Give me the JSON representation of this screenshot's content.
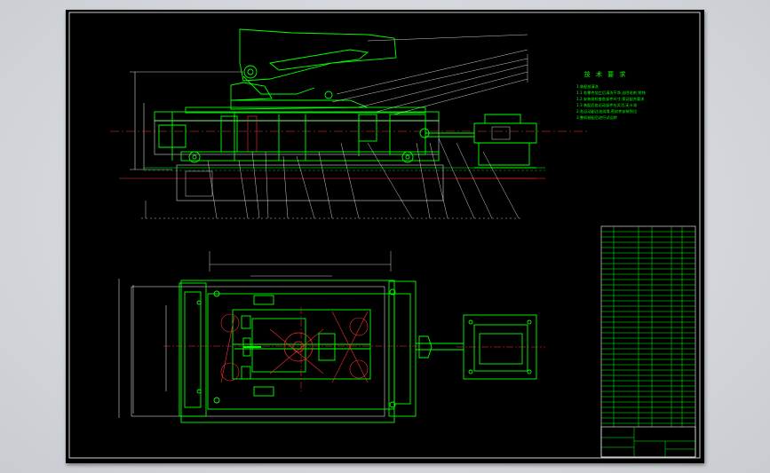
{
  "drawing": {
    "tech_requirements": {
      "title": "技 术 要 求",
      "lines": [
        "1.装配前清洗",
        "1.1 各零件加工后清洗干净,去除毛刺,锈蚀",
        "1.2 安装前检查各部件尺寸,保证配合要求",
        "1.3 装配后各运动部件应灵活,无卡滞",
        "2.各运动副注油润滑,密封件安装到位",
        "3.整机装配后进行试运转"
      ]
    },
    "colors": {
      "background": "#000000",
      "outline": "#00ff00",
      "center_line": "#ff3030",
      "white_line": "#ffffff",
      "text": "#00ff00"
    }
  }
}
